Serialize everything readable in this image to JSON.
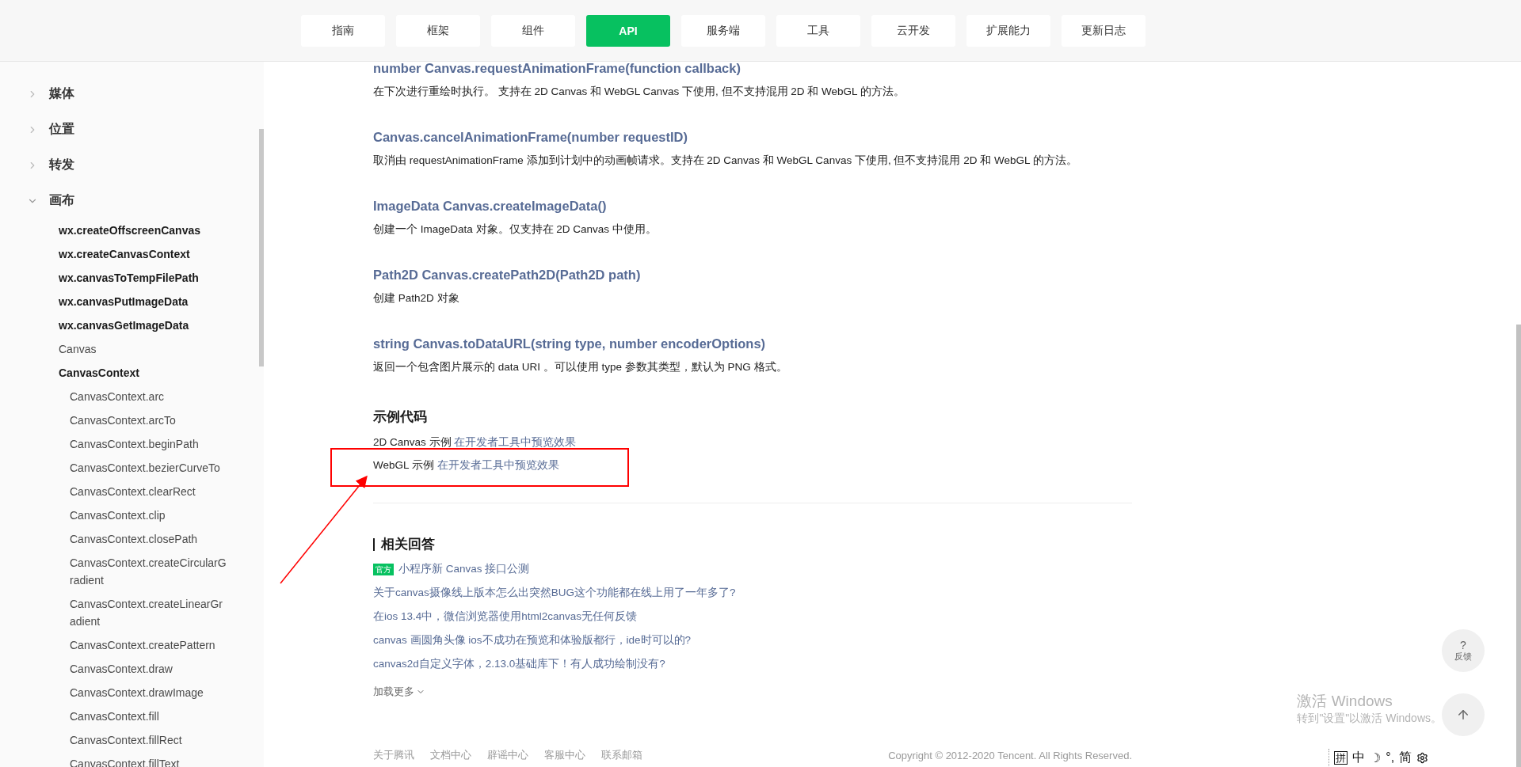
{
  "nav": {
    "tabs": [
      {
        "label": "指南",
        "selected": false
      },
      {
        "label": "框架",
        "selected": false
      },
      {
        "label": "组件",
        "selected": false
      },
      {
        "label": "API",
        "selected": true
      },
      {
        "label": "服务端",
        "selected": false
      },
      {
        "label": "工具",
        "selected": false
      },
      {
        "label": "云开发",
        "selected": false
      },
      {
        "label": "扩展能力",
        "selected": false
      },
      {
        "label": "更新日志",
        "selected": false
      }
    ]
  },
  "sidebar": {
    "groups": [
      {
        "label": "媒体",
        "expanded": false
      },
      {
        "label": "位置",
        "expanded": false
      },
      {
        "label": "转发",
        "expanded": false
      },
      {
        "label": "画布",
        "expanded": true,
        "children": [
          {
            "label": "wx.createOffscreenCanvas",
            "kind": "strong"
          },
          {
            "label": "wx.createCanvasContext",
            "kind": "strong"
          },
          {
            "label": "wx.canvasToTempFilePath",
            "kind": "strong"
          },
          {
            "label": "wx.canvasPutImageData",
            "kind": "strong"
          },
          {
            "label": "wx.canvasGetImageData",
            "kind": "strong"
          },
          {
            "label": "Canvas",
            "kind": "plain"
          },
          {
            "label": "CanvasContext",
            "kind": "strong",
            "children": [
              {
                "label": "CanvasContext.arc"
              },
              {
                "label": "CanvasContext.arcTo"
              },
              {
                "label": "CanvasContext.beginPath"
              },
              {
                "label": "CanvasContext.bezierCurveTo"
              },
              {
                "label": "CanvasContext.clearRect"
              },
              {
                "label": "CanvasContext.clip"
              },
              {
                "label": "CanvasContext.closePath"
              },
              {
                "label": "CanvasContext.createCircularGradient"
              },
              {
                "label": "CanvasContext.createLinearGradient"
              },
              {
                "label": "CanvasContext.createPattern"
              },
              {
                "label": "CanvasContext.draw"
              },
              {
                "label": "CanvasContext.drawImage"
              },
              {
                "label": "CanvasContext.fill"
              },
              {
                "label": "CanvasContext.fillRect"
              },
              {
                "label": "CanvasContext.fillText"
              }
            ]
          }
        ]
      }
    ]
  },
  "methods": [
    {
      "signature": "number Canvas.requestAnimationFrame(function callback)",
      "description": "在下次进行重绘时执行。 支持在 2D Canvas 和 WebGL Canvas 下使用, 但不支持混用 2D 和 WebGL 的方法。"
    },
    {
      "signature": "Canvas.cancelAnimationFrame(number requestID)",
      "description": "取消由 requestAnimationFrame 添加到计划中的动画帧请求。支持在 2D Canvas 和 WebGL Canvas 下使用, 但不支持混用 2D 和 WebGL 的方法。"
    },
    {
      "signature": "ImageData Canvas.createImageData()",
      "description": "创建一个 ImageData 对象。仅支持在 2D Canvas 中使用。"
    },
    {
      "signature": "Path2D Canvas.createPath2D(Path2D path)",
      "description": "创建 Path2D 对象"
    },
    {
      "signature": "string Canvas.toDataURL(string type, number encoderOptions)",
      "description": "返回一个包含图片展示的 data URI 。可以使用 type 参数其类型，默认为 PNG 格式。"
    }
  ],
  "examples": {
    "title": "示例代码",
    "items": [
      {
        "label": "2D Canvas 示例",
        "link": "在开发者工具中预览效果",
        "highlighted": false
      },
      {
        "label": "WebGL 示例",
        "link": "在开发者工具中预览效果",
        "highlighted": true
      }
    ]
  },
  "related": {
    "title": "相关回答",
    "items": [
      {
        "badge": "官方",
        "text": "小程序新 Canvas 接口公测"
      },
      {
        "text": "关于canvas摄像线上版本怎么出突然BUG这个功能都在线上用了一年多了?"
      },
      {
        "text": "在ios 13.4中，微信浏览器使用html2canvas无任何反馈"
      },
      {
        "text": "canvas 画圆角头像 ios不成功在预览和体验版都行，ide时可以的?"
      },
      {
        "text": "canvas2d自定义字体，2.13.0基础库下！有人成功绘制没有?"
      }
    ],
    "more": "加载更多"
  },
  "footer": {
    "links": [
      "关于腾讯",
      "文档中心",
      "辟谣中心",
      "客服中心",
      "联系邮箱"
    ],
    "copyright": "Copyright © 2012-2020 Tencent. All Rights Reserved."
  },
  "feedback": {
    "symbol": "?",
    "label": "反馈"
  },
  "activation": {
    "title": "激活 Windows",
    "subtitle": "转到\"设置\"以激活 Windows。"
  },
  "ime": {
    "items": [
      "拼",
      "中",
      "☽",
      "°,",
      "简"
    ]
  }
}
